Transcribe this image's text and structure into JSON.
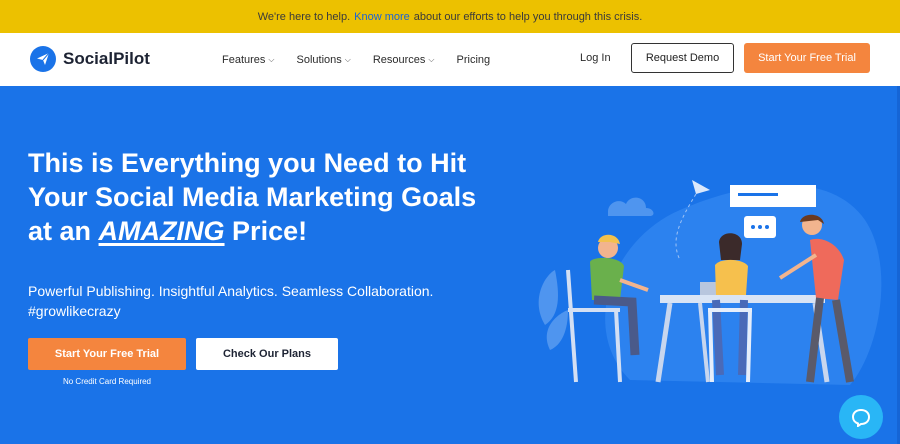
{
  "notice": {
    "text_before": "We're here to help.",
    "link": "Know more",
    "text_after": "about our efforts to help you through this crisis."
  },
  "header": {
    "brand": "SocialPilot",
    "nav": [
      {
        "label": "Features",
        "has_dropdown": true
      },
      {
        "label": "Solutions",
        "has_dropdown": true
      },
      {
        "label": "Resources",
        "has_dropdown": true
      },
      {
        "label": "Pricing",
        "has_dropdown": false
      }
    ],
    "login": "Log In",
    "request_demo": "Request Demo",
    "free_trial": "Start Your Free Trial"
  },
  "hero": {
    "title_line1": "This is Everything you Need to Hit",
    "title_line2": "Your Social Media Marketing Goals",
    "title_line3_pre": "at an",
    "title_emphasis": "AMAZING",
    "title_line3_post": "Price!",
    "subtitle_line1": "Powerful Publishing. Insightful Analytics. Seamless Collaboration.",
    "subtitle_line2": "#growlikecrazy",
    "cta_trial": "Start Your Free Trial",
    "cta_plans": "Check Our Plans",
    "no_cc": "No Credit Card Required"
  },
  "icons": {
    "logo": "paper-plane-icon",
    "chat": "chat-bubble-icon",
    "dropdown": "chevron-down-icon"
  },
  "colors": {
    "notice_bg": "#ecc100",
    "hero_bg": "#1a73e8",
    "accent_orange": "#f4853e",
    "chat_bg": "#29b6f6"
  }
}
